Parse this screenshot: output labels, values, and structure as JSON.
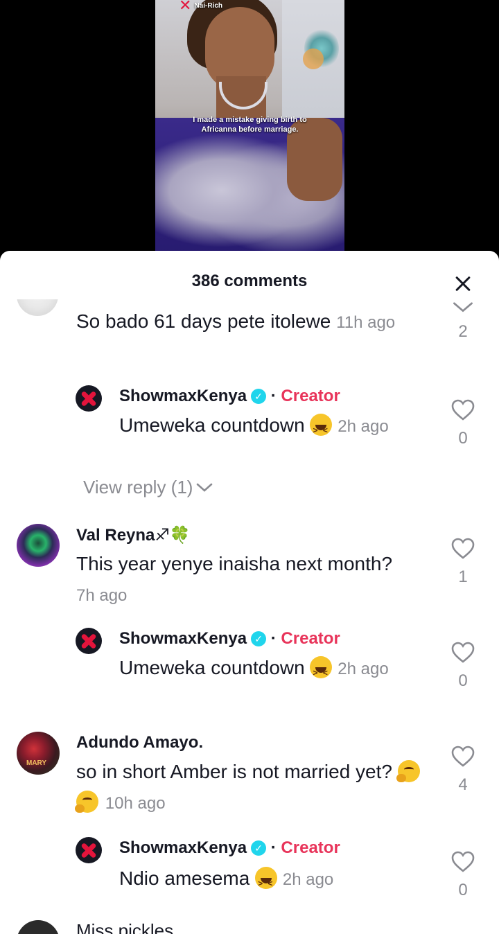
{
  "video": {
    "brand": "Nai-Rich",
    "caption": "I made a mistake giving birth to Africanna before marriage."
  },
  "sheet": {
    "title": "386 comments"
  },
  "comments": [
    {
      "text": "So bado 61 days pete itolewe",
      "time": "11h ago",
      "likes": "2"
    },
    {
      "user": "ShowmaxKenya",
      "tag": "Creator",
      "text": "Umeweka countdown",
      "time": "2h ago",
      "likes": "0"
    },
    {
      "view_reply": "View reply (1)"
    },
    {
      "user": "Val Reyna",
      "user_emoji": "♐🍀",
      "text": "This year yenye inaisha next month?",
      "time": "7h ago",
      "likes": "1"
    },
    {
      "user": "ShowmaxKenya",
      "tag": "Creator",
      "text": "Umeweka countdown",
      "time": "2h ago",
      "likes": "0"
    },
    {
      "user": "Adundo Amayo.",
      "avatar_text": "MARY",
      "text": "so in short Amber is not married yet?",
      "time": "10h ago",
      "likes": "4"
    },
    {
      "user": "ShowmaxKenya",
      "tag": "Creator",
      "text": "Ndio amesema",
      "time": "2h ago",
      "likes": "0"
    },
    {
      "user": "Miss pickles"
    }
  ],
  "colors": {
    "creator": "#e8345a",
    "verified": "#20d5ec",
    "brand_red": "#e3143c"
  }
}
